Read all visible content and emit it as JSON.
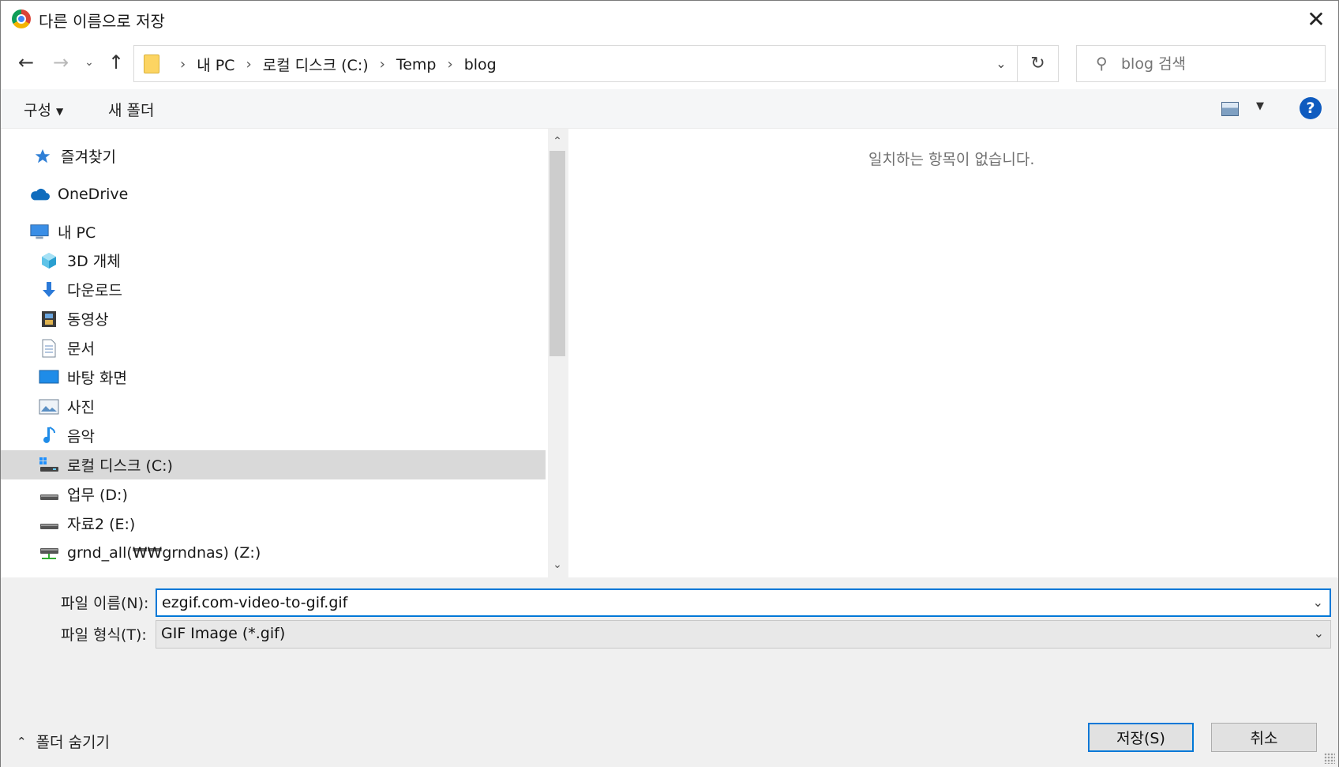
{
  "window": {
    "title": "다른 이름으로 저장",
    "close_glyph": "✕"
  },
  "nav": {
    "back_glyph": "←",
    "forward_glyph": "→",
    "recent_glyph": "⌄",
    "up_glyph": "↑"
  },
  "address": {
    "crumbs": [
      "내 PC",
      "로컬 디스크 (C:)",
      "Temp",
      "blog"
    ],
    "separator": "›",
    "dropdown_glyph": "⌄",
    "refresh_glyph": "↻"
  },
  "search": {
    "placeholder": "blog 검색",
    "icon_glyph": "⚲"
  },
  "toolbar": {
    "organize_label": "구성",
    "organize_caret": "▼",
    "new_folder_label": "새 폴더",
    "view_caret": "▼",
    "help_label": "?"
  },
  "sidebar": {
    "items": [
      {
        "label": "즐겨찾기",
        "icon": "star-icon"
      },
      {
        "label": "OneDrive",
        "icon": "cloud-icon"
      },
      {
        "label": "내 PC",
        "icon": "computer-icon"
      },
      {
        "label": "3D 개체",
        "icon": "cube-icon"
      },
      {
        "label": "다운로드",
        "icon": "download-icon"
      },
      {
        "label": "동영상",
        "icon": "film-icon"
      },
      {
        "label": "문서",
        "icon": "document-icon"
      },
      {
        "label": "바탕 화면",
        "icon": "desktop-icon"
      },
      {
        "label": "사진",
        "icon": "picture-icon"
      },
      {
        "label": "음악",
        "icon": "music-icon"
      },
      {
        "label": "로컬 디스크 (C:)",
        "icon": "windows-drive-icon",
        "selected": true
      },
      {
        "label": "업무 (D:)",
        "icon": "drive-icon"
      },
      {
        "label": "자료2 (E:)",
        "icon": "drive-icon"
      },
      {
        "label": "grnd_all(₩₩grndnas) (Z:)",
        "icon": "network-drive-icon"
      }
    ],
    "scroll_up_glyph": "⌃",
    "scroll_down_glyph": "⌄"
  },
  "content": {
    "empty_message": "일치하는 항목이 없습니다."
  },
  "form": {
    "filename_label": "파일 이름(N):",
    "filename_value": "ezgif.com-video-to-gif.gif",
    "filetype_label": "파일 형식(T):",
    "filetype_value": "GIF Image (*.gif)",
    "caret_glyph": "⌄"
  },
  "footer": {
    "hide_folders_label": "폴더 숨기기",
    "hide_folders_glyph": "⌃",
    "save_label": "저장(S)",
    "cancel_label": "취소"
  },
  "colors": {
    "accent": "#0078d7",
    "help_blue": "#0f5bbf",
    "selection": "#d9d9d9",
    "folder_yellow": "#fcd462"
  }
}
